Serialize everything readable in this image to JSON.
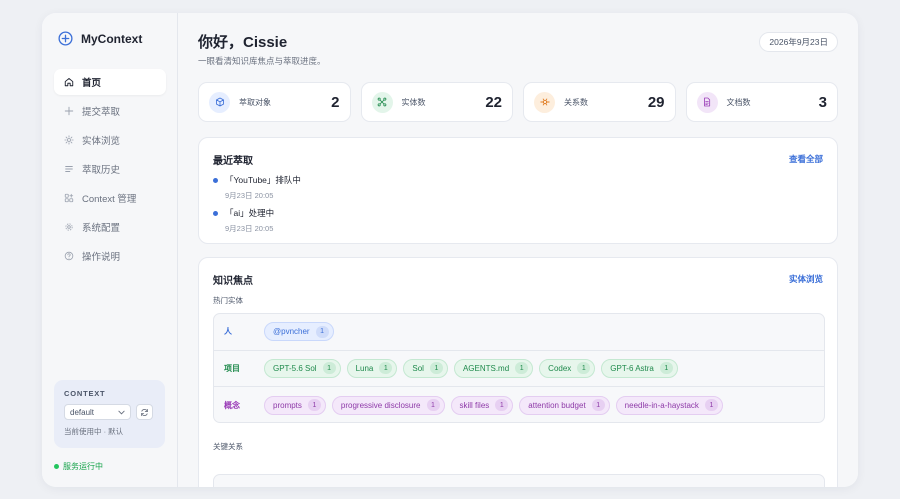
{
  "brand": {
    "name": "MyContext",
    "color": "#3b6fd8"
  },
  "nav": [
    {
      "label": "首页",
      "icon": "home-icon",
      "active": true
    },
    {
      "label": "提交萃取",
      "icon": "plus-icon"
    },
    {
      "label": "实体浏览",
      "icon": "sparkle-icon"
    },
    {
      "label": "萃取历史",
      "icon": "list-icon"
    },
    {
      "label": "Context 管理",
      "icon": "grid-icon"
    },
    {
      "label": "系统配置",
      "icon": "gear-icon"
    },
    {
      "label": "操作说明",
      "icon": "help-icon"
    }
  ],
  "context": {
    "title": "CONTEXT",
    "selected": "default",
    "note": "当前使用中 · 默认"
  },
  "service_status": "服务运行中",
  "header": {
    "greeting": "你好，Cissie",
    "subtitle": "一眼看清知识库焦点与萃取进度。",
    "date": "2026年9月23日"
  },
  "stats": [
    {
      "label": "萃取对象",
      "value": "2",
      "icon": "cube-icon",
      "color": "#3b6fd8",
      "bg": "#e6eeff"
    },
    {
      "label": "实体数",
      "value": "22",
      "icon": "network-icon",
      "color": "#1f8a4c",
      "bg": "#e3f5ea"
    },
    {
      "label": "关系数",
      "value": "29",
      "icon": "link-icon",
      "color": "#e07a1f",
      "bg": "#fdeedd"
    },
    {
      "label": "文档数",
      "value": "3",
      "icon": "document-icon",
      "color": "#9b3fb8",
      "bg": "#f2e5f8"
    }
  ],
  "recent": {
    "title": "最近萃取",
    "link": "查看全部",
    "items": [
      {
        "name": "「YouTube」排队中",
        "time": "9月23日 20:05"
      },
      {
        "name": "「ai」处理中",
        "time": "9月23日 20:05"
      }
    ]
  },
  "focus": {
    "title": "知识焦点",
    "link": "实体浏览",
    "hot_label": "热门实体",
    "relations_label": "关键关系",
    "groups": [
      {
        "type": "人",
        "kind": "person",
        "chips": [
          {
            "name": "@pvncher",
            "count": "1"
          }
        ]
      },
      {
        "type": "项目",
        "kind": "project",
        "chips": [
          {
            "name": "GPT-5.6 Sol",
            "count": "1"
          },
          {
            "name": "Luna",
            "count": "1"
          },
          {
            "name": "Sol",
            "count": "1"
          },
          {
            "name": "AGENTS.md",
            "count": "1"
          },
          {
            "name": "Codex",
            "count": "1"
          },
          {
            "name": "GPT-6 Astra",
            "count": "1"
          }
        ]
      },
      {
        "type": "概念",
        "kind": "concept",
        "chips": [
          {
            "name": "prompts",
            "count": "1"
          },
          {
            "name": "progressive disclosure",
            "count": "1"
          },
          {
            "name": "skill files",
            "count": "1"
          },
          {
            "name": "attention budget",
            "count": "1"
          },
          {
            "name": "needle-in-a-haystack",
            "count": "1"
          }
        ]
      }
    ]
  }
}
